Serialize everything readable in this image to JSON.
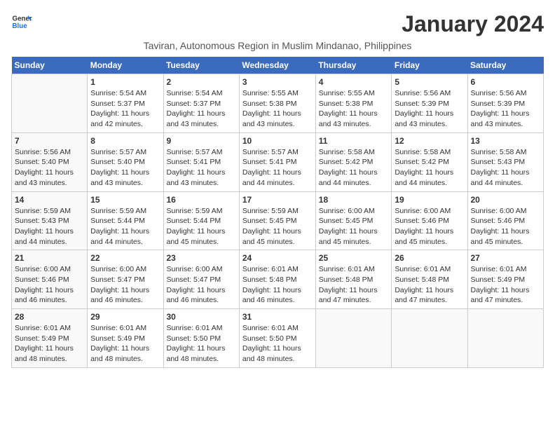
{
  "header": {
    "logo_line1": "General",
    "logo_line2": "Blue",
    "month_title": "January 2024",
    "subtitle": "Taviran, Autonomous Region in Muslim Mindanao, Philippines"
  },
  "weekdays": [
    "Sunday",
    "Monday",
    "Tuesday",
    "Wednesday",
    "Thursday",
    "Friday",
    "Saturday"
  ],
  "weeks": [
    [
      {
        "day": "",
        "detail": ""
      },
      {
        "day": "1",
        "detail": "Sunrise: 5:54 AM\nSunset: 5:37 PM\nDaylight: 11 hours\nand 42 minutes."
      },
      {
        "day": "2",
        "detail": "Sunrise: 5:54 AM\nSunset: 5:37 PM\nDaylight: 11 hours\nand 43 minutes."
      },
      {
        "day": "3",
        "detail": "Sunrise: 5:55 AM\nSunset: 5:38 PM\nDaylight: 11 hours\nand 43 minutes."
      },
      {
        "day": "4",
        "detail": "Sunrise: 5:55 AM\nSunset: 5:38 PM\nDaylight: 11 hours\nand 43 minutes."
      },
      {
        "day": "5",
        "detail": "Sunrise: 5:56 AM\nSunset: 5:39 PM\nDaylight: 11 hours\nand 43 minutes."
      },
      {
        "day": "6",
        "detail": "Sunrise: 5:56 AM\nSunset: 5:39 PM\nDaylight: 11 hours\nand 43 minutes."
      }
    ],
    [
      {
        "day": "7",
        "detail": "Sunrise: 5:56 AM\nSunset: 5:40 PM\nDaylight: 11 hours\nand 43 minutes."
      },
      {
        "day": "8",
        "detail": "Sunrise: 5:57 AM\nSunset: 5:40 PM\nDaylight: 11 hours\nand 43 minutes."
      },
      {
        "day": "9",
        "detail": "Sunrise: 5:57 AM\nSunset: 5:41 PM\nDaylight: 11 hours\nand 43 minutes."
      },
      {
        "day": "10",
        "detail": "Sunrise: 5:57 AM\nSunset: 5:41 PM\nDaylight: 11 hours\nand 44 minutes."
      },
      {
        "day": "11",
        "detail": "Sunrise: 5:58 AM\nSunset: 5:42 PM\nDaylight: 11 hours\nand 44 minutes."
      },
      {
        "day": "12",
        "detail": "Sunrise: 5:58 AM\nSunset: 5:42 PM\nDaylight: 11 hours\nand 44 minutes."
      },
      {
        "day": "13",
        "detail": "Sunrise: 5:58 AM\nSunset: 5:43 PM\nDaylight: 11 hours\nand 44 minutes."
      }
    ],
    [
      {
        "day": "14",
        "detail": "Sunrise: 5:59 AM\nSunset: 5:43 PM\nDaylight: 11 hours\nand 44 minutes."
      },
      {
        "day": "15",
        "detail": "Sunrise: 5:59 AM\nSunset: 5:44 PM\nDaylight: 11 hours\nand 44 minutes."
      },
      {
        "day": "16",
        "detail": "Sunrise: 5:59 AM\nSunset: 5:44 PM\nDaylight: 11 hours\nand 45 minutes."
      },
      {
        "day": "17",
        "detail": "Sunrise: 5:59 AM\nSunset: 5:45 PM\nDaylight: 11 hours\nand 45 minutes."
      },
      {
        "day": "18",
        "detail": "Sunrise: 6:00 AM\nSunset: 5:45 PM\nDaylight: 11 hours\nand 45 minutes."
      },
      {
        "day": "19",
        "detail": "Sunrise: 6:00 AM\nSunset: 5:46 PM\nDaylight: 11 hours\nand 45 minutes."
      },
      {
        "day": "20",
        "detail": "Sunrise: 6:00 AM\nSunset: 5:46 PM\nDaylight: 11 hours\nand 45 minutes."
      }
    ],
    [
      {
        "day": "21",
        "detail": "Sunrise: 6:00 AM\nSunset: 5:46 PM\nDaylight: 11 hours\nand 46 minutes."
      },
      {
        "day": "22",
        "detail": "Sunrise: 6:00 AM\nSunset: 5:47 PM\nDaylight: 11 hours\nand 46 minutes."
      },
      {
        "day": "23",
        "detail": "Sunrise: 6:00 AM\nSunset: 5:47 PM\nDaylight: 11 hours\nand 46 minutes."
      },
      {
        "day": "24",
        "detail": "Sunrise: 6:01 AM\nSunset: 5:48 PM\nDaylight: 11 hours\nand 46 minutes."
      },
      {
        "day": "25",
        "detail": "Sunrise: 6:01 AM\nSunset: 5:48 PM\nDaylight: 11 hours\nand 47 minutes."
      },
      {
        "day": "26",
        "detail": "Sunrise: 6:01 AM\nSunset: 5:48 PM\nDaylight: 11 hours\nand 47 minutes."
      },
      {
        "day": "27",
        "detail": "Sunrise: 6:01 AM\nSunset: 5:49 PM\nDaylight: 11 hours\nand 47 minutes."
      }
    ],
    [
      {
        "day": "28",
        "detail": "Sunrise: 6:01 AM\nSunset: 5:49 PM\nDaylight: 11 hours\nand 48 minutes."
      },
      {
        "day": "29",
        "detail": "Sunrise: 6:01 AM\nSunset: 5:49 PM\nDaylight: 11 hours\nand 48 minutes."
      },
      {
        "day": "30",
        "detail": "Sunrise: 6:01 AM\nSunset: 5:50 PM\nDaylight: 11 hours\nand 48 minutes."
      },
      {
        "day": "31",
        "detail": "Sunrise: 6:01 AM\nSunset: 5:50 PM\nDaylight: 11 hours\nand 48 minutes."
      },
      {
        "day": "",
        "detail": ""
      },
      {
        "day": "",
        "detail": ""
      },
      {
        "day": "",
        "detail": ""
      }
    ]
  ]
}
